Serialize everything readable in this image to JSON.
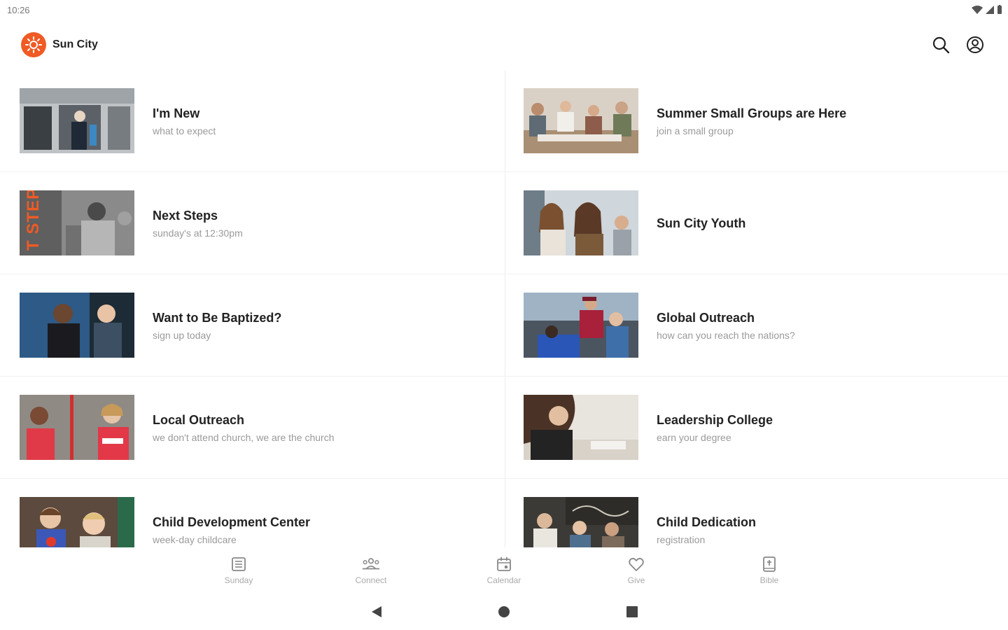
{
  "status": {
    "time": "10:26"
  },
  "app": {
    "title": "Sun City",
    "brand_color": "#f05a24"
  },
  "cards": [
    {
      "title": "I'm New",
      "subtitle": "what to expect"
    },
    {
      "title": "Summer Small Groups are Here",
      "subtitle": "join a small group"
    },
    {
      "title": "Next Steps",
      "subtitle": "sunday's at 12:30pm"
    },
    {
      "title": "Sun City Youth",
      "subtitle": ""
    },
    {
      "title": "Want to Be Baptized?",
      "subtitle": "sign up today"
    },
    {
      "title": "Global Outreach",
      "subtitle": "how can you reach the nations?"
    },
    {
      "title": "Local Outreach",
      "subtitle": "we don't attend church, we are the church"
    },
    {
      "title": "Leadership College",
      "subtitle": "earn your degree"
    },
    {
      "title": "Child Development Center",
      "subtitle": "week-day childcare"
    },
    {
      "title": "Child Dedication",
      "subtitle": "registration"
    }
  ],
  "thumb_texts": {
    "next_steps": "T STEPS"
  },
  "nav": [
    {
      "label": "Sunday",
      "icon": "sunday-icon"
    },
    {
      "label": "Connect",
      "icon": "connect-icon"
    },
    {
      "label": "Calendar",
      "icon": "calendar-icon"
    },
    {
      "label": "Give",
      "icon": "heart-icon"
    },
    {
      "label": "Bible",
      "icon": "bible-icon"
    }
  ]
}
